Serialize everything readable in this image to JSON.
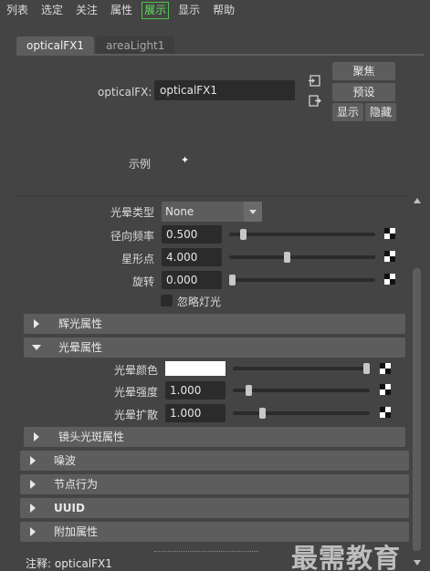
{
  "menubar": {
    "items": [
      "列表",
      "选定",
      "关注",
      "属性",
      "展示",
      "显示",
      "帮助"
    ],
    "active_index": 4
  },
  "tabs": [
    {
      "label": "opticalFX1",
      "selected": true
    },
    {
      "label": "areaLight1",
      "selected": false
    }
  ],
  "node": {
    "type_label": "opticalFX:",
    "name_value": "opticalFX1"
  },
  "buttons": {
    "focus": "聚焦",
    "presets": "预设",
    "show": "显示",
    "hide": "隐藏"
  },
  "swatch": {
    "label": "示例"
  },
  "halo_type": {
    "label": "光晕类型",
    "value": "None"
  },
  "glow_rows": [
    {
      "label": "径向频率",
      "value": "0.500",
      "slider_fraction": 0.08
    },
    {
      "label": "星形点",
      "value": "4.000",
      "slider_fraction": 0.39
    },
    {
      "label": "旋转",
      "value": "0.000",
      "slider_fraction": 0.0
    }
  ],
  "ignore_lights": {
    "label": "忽略灯光",
    "checked": false
  },
  "sections": {
    "glow": {
      "label": "辉光属性",
      "expanded": false
    },
    "halo": {
      "label": "光晕属性",
      "expanded": true
    },
    "lens_flare": {
      "label": "镜头光斑属性",
      "expanded": false
    },
    "noise": {
      "label": "噪波",
      "expanded": false
    },
    "node_behavior": {
      "label": "节点行为",
      "expanded": false
    },
    "uuid": {
      "label": "UUID",
      "expanded": false
    },
    "extra": {
      "label": "附加属性",
      "expanded": false
    }
  },
  "halo_rows": {
    "color": {
      "label": "光晕颜色",
      "color": "#ffffff",
      "slider_fraction": 1.0
    },
    "intensity": {
      "label": "光晕强度",
      "value": "1.000",
      "slider_fraction": 0.1
    },
    "spread": {
      "label": "光晕扩散",
      "value": "1.000",
      "slider_fraction": 0.2
    }
  },
  "notes": {
    "text": "注释:  opticalFX1"
  },
  "watermark": "最需教育",
  "colors": {
    "active_menu": "#5fe05f",
    "background": "#444444",
    "field": "#2b2b2b",
    "button": "#5d5d5d"
  }
}
